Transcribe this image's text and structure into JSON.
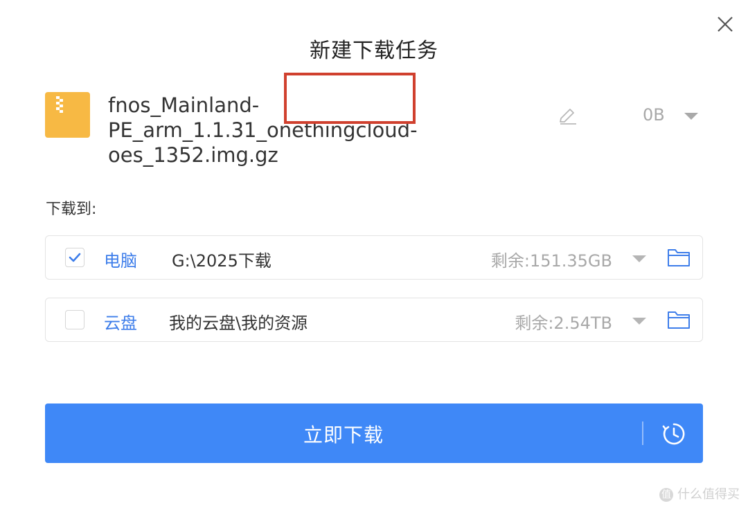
{
  "dialog": {
    "title": "新建下载任务",
    "close_icon": "close-icon"
  },
  "file": {
    "icon": "zip-file-icon",
    "name_line1": "fnos_Mainland-PE_arm_1.1.31_onethingcloud-",
    "name_line2": "oes_1352.img.gz",
    "size": "0B",
    "edit_icon": "pencil-icon",
    "size_dropdown_icon": "caret-down-icon"
  },
  "destination": {
    "label": "下载到:",
    "rows": [
      {
        "type": "电脑",
        "path": "G:\\2025下载",
        "free": "剩余:151.35GB",
        "checked": true
      },
      {
        "type": "云盘",
        "path": "我的云盘\\我的资源",
        "free": "剩余:2.54TB",
        "checked": false
      }
    ]
  },
  "action": {
    "download_label": "立即下载",
    "schedule_icon": "clock-schedule-icon"
  },
  "watermark": {
    "badge": "值",
    "text": "什么值得买"
  },
  "colors": {
    "accent": "#3f88f7",
    "link_blue": "#3d7dea",
    "file_icon": "#f7b944",
    "highlight": "#d0402e",
    "muted_text": "#a8a8a8"
  }
}
